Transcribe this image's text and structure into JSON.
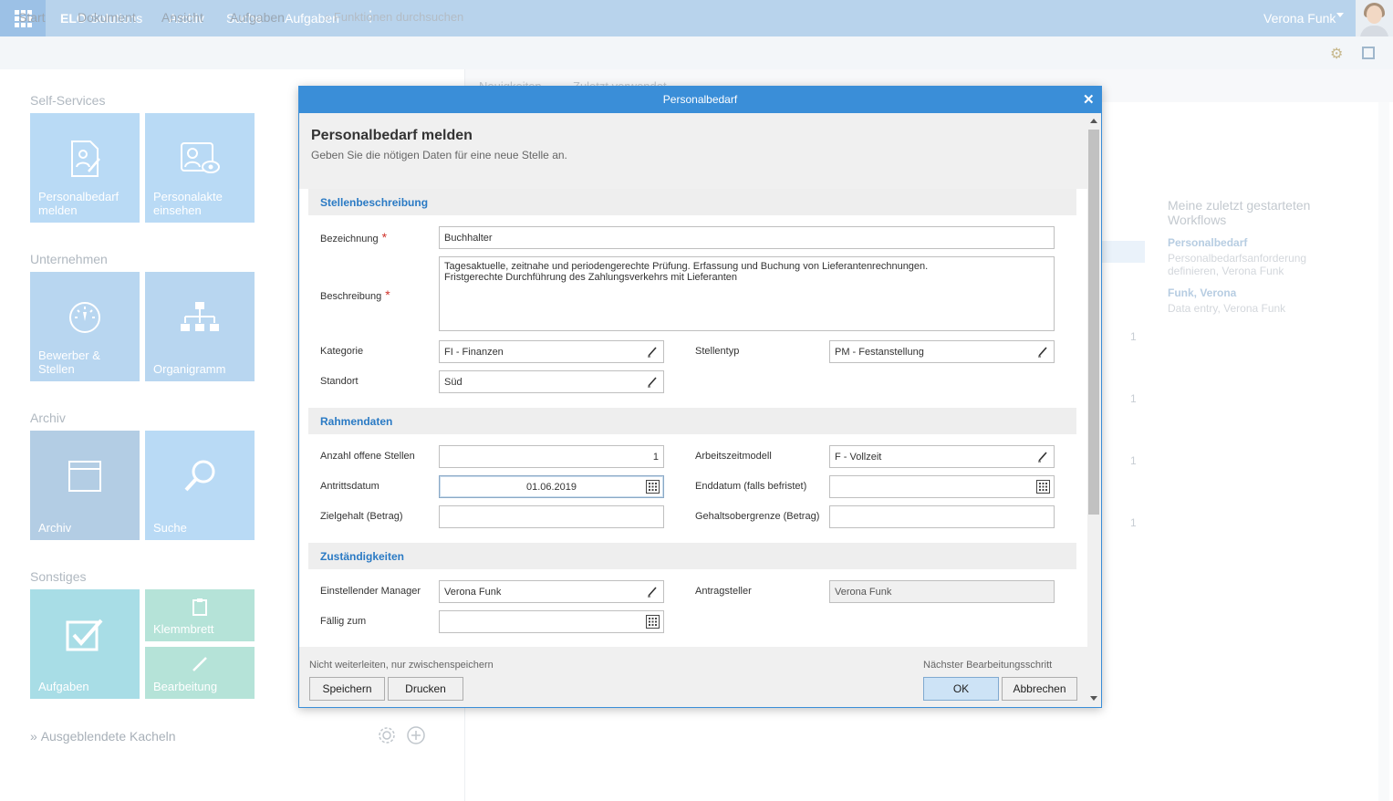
{
  "topbar": {
    "brand_bold": "ELO",
    "brand_rest": "Solutions",
    "nav": [
      "Archiv",
      "Suche",
      "Aufgaben"
    ],
    "user_name": "Verona Funk"
  },
  "ribbon": {
    "items": [
      "Start",
      "Dokument",
      "Ansicht",
      "Aufgaben"
    ],
    "search_placeholder": "Funktionen durchsuchen"
  },
  "tiles": {
    "self_services": {
      "title": "Self-Services",
      "t1": "Personalbedarf melden",
      "t2": "Personalakte einsehen"
    },
    "unternehmen": {
      "title": "Unternehmen",
      "t1": "Bewerber & Stellen",
      "t2": "Organigramm"
    },
    "archiv": {
      "title": "Archiv",
      "t1": "Archiv",
      "t2": "Suche"
    },
    "sonstiges": {
      "title": "Sonstiges",
      "t1": "Aufgaben",
      "t2": "Klemmbrett",
      "t3": "Bearbeitung"
    },
    "hidden": "Ausgeblendete Kacheln"
  },
  "background": {
    "tabs": [
      "Neuigkeiten",
      "Zuletzt verwendet"
    ],
    "counts": [
      "1",
      "1",
      "1",
      "1"
    ],
    "workflows_title": "Meine zuletzt gestarteten Workflows",
    "wf1_title": "Personalbedarf",
    "wf1_sub": "Personalbedarfsanforderung definieren, Verona Funk",
    "wf2_title": "Funk, Verona",
    "wf2_sub": "Data entry, Verona Funk"
  },
  "dialog": {
    "titlebar": "Personalbedarf",
    "close": "✕",
    "heading": "Personalbedarf melden",
    "subheading": "Geben Sie die nötigen Daten für eine neue Stelle an.",
    "sections": {
      "stellen": "Stellenbeschreibung",
      "rahmen": "Rahmendaten",
      "zust": "Zuständigkeiten"
    },
    "fields": {
      "bezeichnung_label": "Bezeichnung",
      "bezeichnung_value": "Buchhalter",
      "beschreibung_label": "Beschreibung",
      "beschreibung_line1": "Tagesaktuelle, zeitnahe und periodengerechte Prüfung. Erfassung und Buchung von Lieferantenrechnungen.",
      "beschreibung_line2": "Fristgerechte Durchführung des Zahlungsverkehrs mit Lieferanten",
      "kategorie_label": "Kategorie",
      "kategorie_value": "FI - Finanzen",
      "stellentyp_label": "Stellentyp",
      "stellentyp_value": "PM - Festanstellung",
      "standort_label": "Standort",
      "standort_value": "Süd",
      "anzahl_label": "Anzahl offene Stellen",
      "anzahl_value": "1",
      "arbeitszeit_label": "Arbeitszeitmodell",
      "arbeitszeit_value": "F - Vollzeit",
      "antritt_label": "Antrittsdatum",
      "antritt_value": "01.06.2019",
      "enddatum_label": "Enddatum (falls befristet)",
      "enddatum_value": "",
      "zielgehalt_label": "Zielgehalt (Betrag)",
      "zielgehalt_value": "",
      "obergrenze_label": "Gehaltsobergrenze (Betrag)",
      "obergrenze_value": "",
      "manager_label": "Einstellender Manager",
      "manager_value": "Verona Funk",
      "antragsteller_label": "Antragsteller",
      "antragsteller_value": "Verona Funk",
      "faellig_label": "Fällig zum",
      "faellig_value": ""
    },
    "footer": {
      "left_label": "Nicht weiterleiten, nur zwischenspeichern",
      "save": "Speichern",
      "print": "Drucken",
      "right_label": "Nächster Bearbeitungsschritt",
      "ok": "OK",
      "cancel": "Abbrechen"
    }
  },
  "colors": {
    "topbar": "#b8d3ec",
    "dialog_accent": "#3a8ed8",
    "section_title": "#2a7ac4",
    "required": "#d0342c",
    "tile_blue": "#b9daf5",
    "tile_teal": "#a8dde6",
    "tile_mint": "#b5e3d8"
  }
}
